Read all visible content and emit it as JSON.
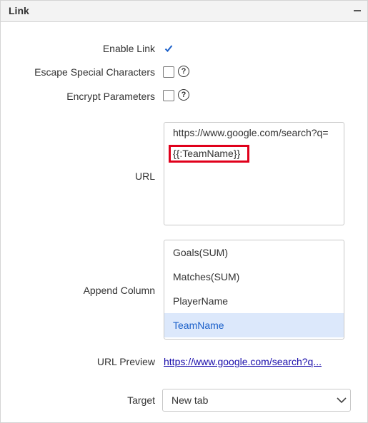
{
  "panel": {
    "title": "Link"
  },
  "fields": {
    "enable_link": {
      "label": "Enable Link",
      "checked": true
    },
    "escape_special": {
      "label": "Escape Special Characters",
      "checked": false,
      "help": "?"
    },
    "encrypt_params": {
      "label": "Encrypt Parameters",
      "checked": false,
      "help": "?"
    },
    "url": {
      "label": "URL",
      "line1": "https://www.google.com/search?q=",
      "line2": "{{:TeamName}}"
    },
    "append_column": {
      "label": "Append Column",
      "items": [
        {
          "label": "Goals(SUM)",
          "selected": false
        },
        {
          "label": "Matches(SUM)",
          "selected": false
        },
        {
          "label": "PlayerName",
          "selected": false
        },
        {
          "label": "TeamName",
          "selected": true
        }
      ]
    },
    "url_preview": {
      "label": "URL Preview",
      "value": "https://www.google.com/search?q..."
    },
    "target": {
      "label": "Target",
      "value": "New tab"
    }
  },
  "colors": {
    "accent": "#1a5fc9",
    "highlight_border": "#e0001b",
    "selected_bg": "#dce8fb",
    "link": "#1a0dab"
  }
}
